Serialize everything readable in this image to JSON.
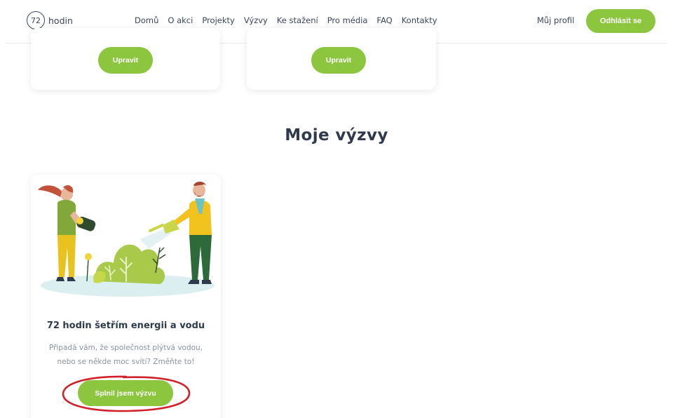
{
  "header": {
    "logo_number": "72",
    "logo_text": "hodin",
    "nav": [
      "Domů",
      "O akci",
      "Projekty",
      "Výzvy",
      "Ke stažení",
      "Pro média",
      "FAQ",
      "Kontakty"
    ],
    "profile_link": "Můj profil",
    "logout_button": "Odhlásit se"
  },
  "projects": {
    "cards": [
      {
        "button": "Upravit"
      },
      {
        "button": "Upravit"
      }
    ]
  },
  "challenges": {
    "section_title": "Moje výzvy",
    "card": {
      "title": "72 hodin šetřím energii a vodu",
      "description": "Připadá vám, že společnost plýtvá vodou, nebo se někde moc svítí? Změňte to!",
      "button": "Splnil jsem výzvu"
    }
  },
  "colors": {
    "accent": "#8cc63f",
    "text": "#2f3b4c",
    "muted": "#8a929c",
    "highlight": "#d0202a"
  }
}
